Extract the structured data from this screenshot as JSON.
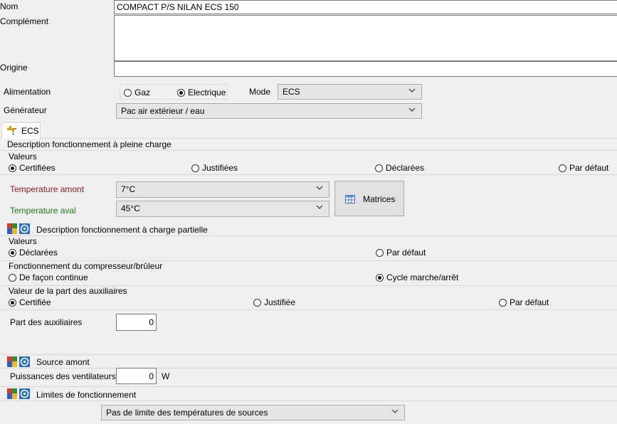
{
  "identity": {
    "nom_label": "Nom",
    "nom_value": "COMPACT P/S NILAN ECS 150",
    "complement_label": "Complément",
    "complement_value": "",
    "origine_label": "Origine",
    "origine_value": ""
  },
  "alimentation": {
    "label": "Alimentation",
    "options": [
      "Gaz",
      "Electrique"
    ],
    "selected": "Electrique",
    "mode_label": "Mode",
    "mode_value": "ECS"
  },
  "generateur": {
    "label": "Générateur",
    "value": "Pac air extérieur / eau"
  },
  "tab": {
    "label": "ECS"
  },
  "pleine_charge": {
    "title": "Description fonctionnement à pleine charge",
    "valeurs_label": "Valeurs",
    "options": [
      "Certifiées",
      "Justifiées",
      "Déclarées",
      "Par défaut"
    ],
    "selected": "Certifiées",
    "temp_amont_label": "Temperature amont",
    "temp_amont_value": "7°C",
    "temp_aval_label": "Temperature aval",
    "temp_aval_value": "45°C",
    "matrices_label": "Matrices",
    "colors": {
      "amont": "#8b1a1a",
      "aval": "#1f7a1f"
    }
  },
  "charge_partielle": {
    "title": "Description fonctionnement à charge partielle",
    "valeurs_label": "Valeurs",
    "valeurs_options": [
      "Déclarées",
      "Par défaut"
    ],
    "valeurs_selected": "Déclarées",
    "compresseur_label": "Fonctionnement du compresseur/brûleur",
    "compresseur_options": [
      "De façon continue",
      "Cycle marche/arrêt"
    ],
    "compresseur_selected": "Cycle marche/arrêt",
    "auxiliaires_label": "Valeur de la part des auxiliaires",
    "auxiliaires_options": [
      "Certifiée",
      "Justifiée",
      "Par défaut"
    ],
    "auxiliaires_selected": "Certifiée",
    "part_label": "Part des auxiliaires",
    "part_value": "0"
  },
  "source_amont": {
    "title": "Source amont",
    "puissance_label": "Puissances des ventilateurs",
    "puissance_value": "0",
    "puissance_unit": "W"
  },
  "limites": {
    "title": "Limites de fonctionnement",
    "value": "Pas de limite des températures de sources"
  }
}
